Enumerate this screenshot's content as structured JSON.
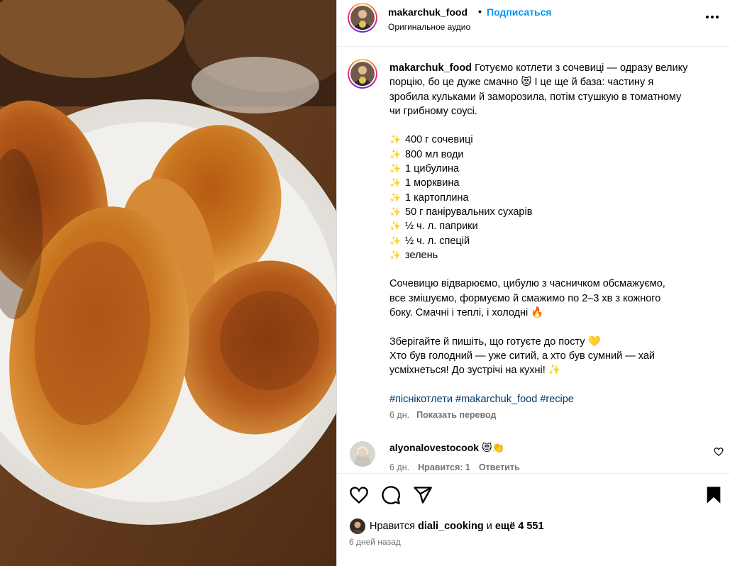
{
  "post": {
    "username": "makarchuk_food",
    "dot": "•",
    "follow_label": "Подписаться",
    "audio_label": "Оригинальное аудио",
    "more_label": "•••"
  },
  "caption": {
    "username": "makarchuk_food",
    "intro": [
      "Готуємо котлети з сочевиці — одразу велику",
      "порцію, бо це дуже смачно 😻 І це ще й база: частину я",
      "зробила кульками й заморозила, потім стушкую в томатному",
      "чи грибному соусі."
    ],
    "sparkle": "✨",
    "ingredients": [
      "400 г сочевиці",
      "800 мл води",
      "1 цибулина",
      "1 морквина",
      "1 картоплина",
      "50 г панірувальних сухарів",
      "½ ч. л. паприки",
      "½ ч. л. спецій",
      "зелень"
    ],
    "method": [
      "Сочевицю відварюємо, цибулю з часничком обсмажуємо,",
      "все змішуємо, формуємо й смажимо по 2–3 хв з кожного",
      "боку. Смачні і теплі, і холодні 🔥"
    ],
    "outro": [
      "Зберігайте й пишіть, що готуєте до посту 💛",
      "Хто був голодний — уже ситий, а хто був сумний — хай",
      "усміхнеться! До зустрічі на кухні! ✨"
    ],
    "hashtags": [
      "#піснікотлети",
      "#makarchuk_food",
      "#recipe"
    ],
    "age": "6 дн.",
    "translate_label": "Показать перевод"
  },
  "comment": {
    "username": "alyonalovestocook",
    "text": "😻👏",
    "age": "6 дн.",
    "likes_label": "Нравится: 1",
    "reply_label": "Ответить"
  },
  "likes": {
    "prefix": "Нравится",
    "liker": "diali_cooking",
    "joiner": "и",
    "others": "ещё 4 551"
  },
  "timestamp": "6 дней назад",
  "icons": [
    "heart-icon",
    "comment-icon",
    "share-icon",
    "bookmark-icon",
    "more-icon"
  ],
  "colors": {
    "accent": "#0095f6",
    "muted": "#737373",
    "hashtag": "#00376b"
  }
}
